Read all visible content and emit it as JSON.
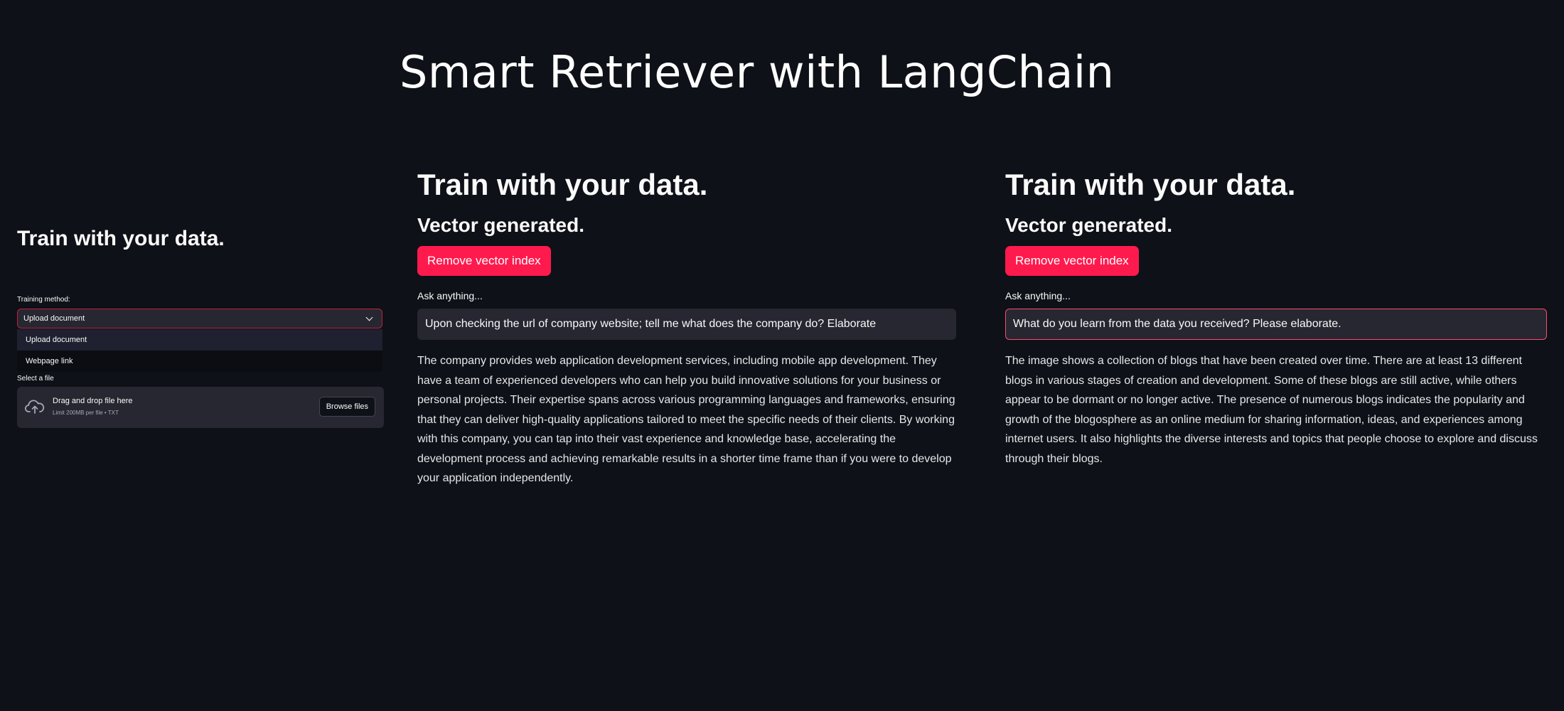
{
  "app": {
    "title": "Smart Retriever with LangChain"
  },
  "panel_upload": {
    "heading": "Train with your data.",
    "training_method_label": "Training method:",
    "selected_option": "Upload document",
    "options": [
      "Upload document",
      "Webpage link"
    ],
    "file_label": "Select a file",
    "dropzone_title": "Drag and drop file here",
    "dropzone_limit": "Limit 200MB per file • TXT",
    "browse_label": "Browse files"
  },
  "panel_company": {
    "heading": "Train with your data.",
    "status": "Vector generated.",
    "remove_label": "Remove vector index",
    "ask_label": "Ask anything...",
    "question": "Upon checking the url of company website; tell me what does the company do? Elaborate",
    "answer": "The company provides web application development services, including mobile app development. They have a team of experienced developers who can help you build innovative solutions for your business or personal projects. Their expertise spans across various programming languages and frameworks, ensuring that they can deliver high-quality applications tailored to meet the specific needs of their clients. By working with this company, you can tap into their vast experience and knowledge base, accelerating the development process and achieving remarkable results in a shorter time frame than if you were to develop your application independently."
  },
  "panel_blogs": {
    "heading": "Train with your data.",
    "status": "Vector generated.",
    "remove_label": "Remove vector index",
    "ask_label": "Ask anything...",
    "question": "What do you learn from the data you received? Please elaborate.",
    "answer": "The image shows a collection of blogs that have been created over time. There are at least 13 different blogs in various stages of creation and development. Some of these blogs are still active, while others appear to be dormant or no longer active. The presence of numerous blogs indicates the popularity and growth of the blogosphere as an online medium for sharing information, ideas, and experiences among internet users. It also highlights the diverse interests and topics that people choose to explore and discuss through their blogs."
  },
  "colors": {
    "background": "#0e1117",
    "primary_button": "#ff1a4d",
    "focus_border": "#ff4b6e",
    "input_background": "#262730"
  },
  "icons": {
    "upload": "cloud-upload-icon",
    "dropdown": "chevron-down-icon"
  }
}
